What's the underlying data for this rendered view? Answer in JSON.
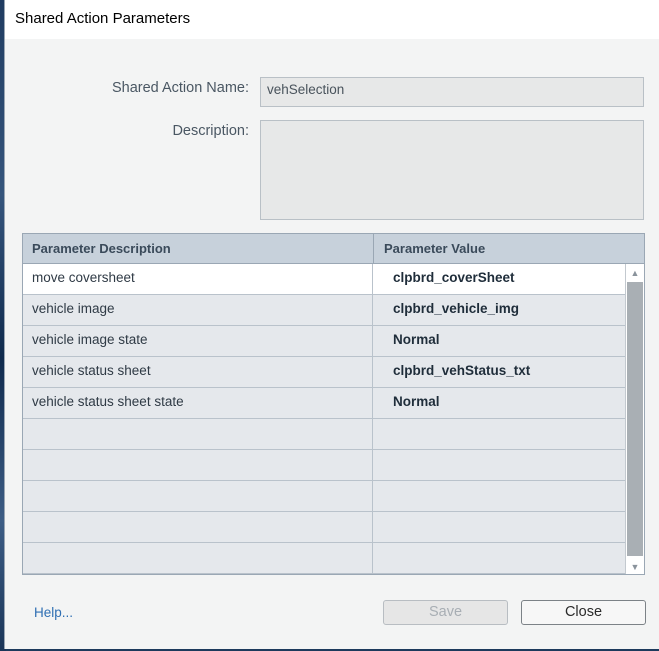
{
  "window": {
    "title": "Shared Action Parameters"
  },
  "form": {
    "name_label": "Shared Action Name:",
    "name_value": "vehSelection",
    "description_label": "Description:",
    "description_value": ""
  },
  "table": {
    "columns": [
      "Parameter Description",
      "Parameter Value"
    ],
    "rows": [
      {
        "description": "move coversheet",
        "value": "clpbrd_coverSheet"
      },
      {
        "description": "vehicle image",
        "value": "clpbrd_vehicle_img"
      },
      {
        "description": "vehicle image state",
        "value": "Normal"
      },
      {
        "description": "vehicle status sheet",
        "value": "clpbrd_vehStatus_txt"
      },
      {
        "description": "vehicle status sheet state",
        "value": "Normal"
      },
      {
        "description": "",
        "value": ""
      },
      {
        "description": "",
        "value": ""
      },
      {
        "description": "",
        "value": ""
      },
      {
        "description": "",
        "value": ""
      },
      {
        "description": "",
        "value": ""
      }
    ]
  },
  "footer": {
    "help_label": "Help...",
    "save_label": "Save",
    "close_label": "Close"
  },
  "icons": {
    "scroll_up": "chevron-up-icon",
    "scroll_down": "chevron-down-icon"
  }
}
